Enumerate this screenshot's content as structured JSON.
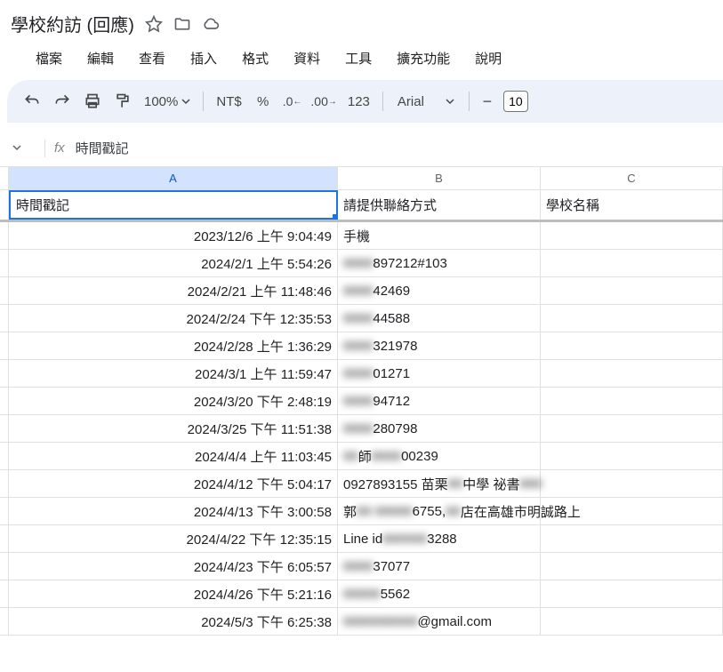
{
  "doc": {
    "title": "學校約訪 (回應)"
  },
  "menu": {
    "file": "檔案",
    "edit": "編輯",
    "view": "查看",
    "insert": "插入",
    "format": "格式",
    "data": "資料",
    "tools": "工具",
    "extensions": "擴充功能",
    "help": "說明"
  },
  "toolbar": {
    "zoom": "100%",
    "currency": "NT$",
    "percent": "%",
    "dec_dec": ".0",
    "inc_dec": ".00",
    "number": "123",
    "font": "Arial",
    "size": "10"
  },
  "formula": {
    "fx": "fx",
    "text": "時間戳記"
  },
  "columns": {
    "a": "A",
    "b": "B",
    "c": "C"
  },
  "headers": {
    "a": "時間戳記",
    "b": "請提供聯絡方式",
    "c": "學校名稱"
  },
  "rows": [
    {
      "a": "2023/12/6 上午 9:04:49",
      "b": "手機",
      "c": ""
    },
    {
      "a": "2024/2/1 上午 5:54:26",
      "b": "897212#103",
      "c": ""
    },
    {
      "a": "2024/2/21 上午 11:48:46",
      "b": "42469",
      "c": ""
    },
    {
      "a": "2024/2/24 下午 12:35:53",
      "b": "44588",
      "c": ""
    },
    {
      "a": "2024/2/28 上午 1:36:29",
      "b": "321978",
      "c": ""
    },
    {
      "a": "2024/3/1 上午 11:59:47",
      "b": "01271",
      "c": ""
    },
    {
      "a": "2024/3/20 下午 2:48:19",
      "b": "94712",
      "c": ""
    },
    {
      "a": "2024/3/25 下午 11:51:38",
      "b": "280798",
      "c": ""
    },
    {
      "a": "2024/4/4 上午 11:03:45",
      "b_prefix": "師",
      "b": "00239",
      "c": ""
    },
    {
      "a": "2024/4/12 下午 5:04:17",
      "b": "0927893155 苗栗",
      "b_suffix": "中學 祕書",
      "c": ""
    },
    {
      "a": "2024/4/13 下午 3:00:58",
      "b": "郭",
      "b_mid": "6755,",
      "b_suffix": "店在高雄市明誠路上",
      "c": ""
    },
    {
      "a": "2024/4/22 下午 12:35:15",
      "b": "Line id",
      "b_suffix": "3288",
      "c": ""
    },
    {
      "a": "2024/4/23 下午 6:05:57",
      "b": "37077",
      "c": ""
    },
    {
      "a": "2024/4/26 下午 5:21:16",
      "b": "5562",
      "c": ""
    },
    {
      "a": "2024/5/3 下午 6:25:38",
      "b": "@gmail.com",
      "c": ""
    }
  ]
}
